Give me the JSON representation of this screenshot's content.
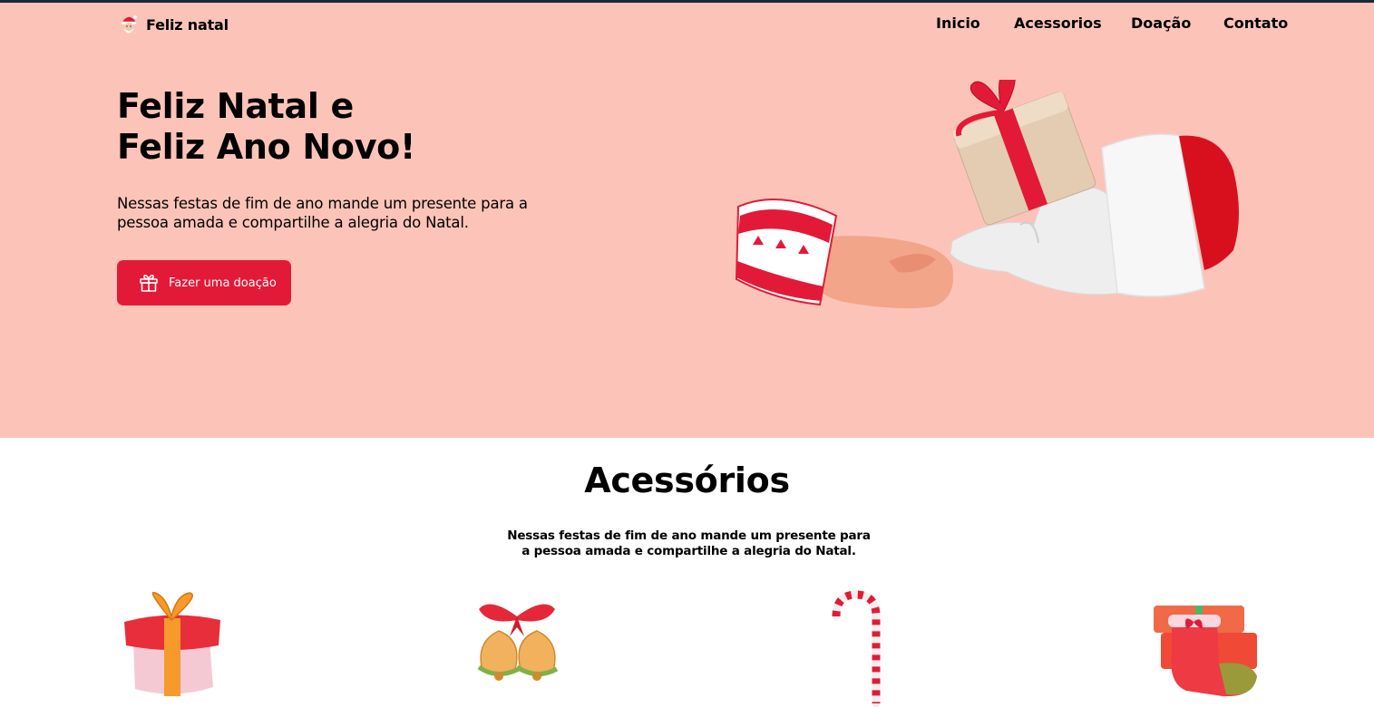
{
  "brand": {
    "name": "Feliz natal",
    "icon": "santa-icon"
  },
  "nav": {
    "items": [
      "Inicio",
      "Acessorios",
      "Doação",
      "Contato"
    ]
  },
  "hero": {
    "title_line1": "Feliz Natal e",
    "title_line2": "Feliz Ano Novo!",
    "text": "Nessas festas de fim de ano mande um presente para a pessoa amada e compartilhe a alegria do Natal.",
    "cta_label": "Fazer uma doação",
    "cta_icon": "gift-icon",
    "image": "hands-giving-gift-illustration"
  },
  "accessories": {
    "title": "Acessórios",
    "text": "Nessas festas de fim de ano mande um presente para a pessoa amada e compartilhe a alegria do Natal.",
    "items": [
      {
        "icon": "gift-box-icon"
      },
      {
        "icon": "christmas-bells-icon"
      },
      {
        "icon": "candy-cane-icon"
      },
      {
        "icon": "christmas-stocking-icon"
      }
    ]
  },
  "colors": {
    "hero_bg": "#fcc4b9",
    "accent": "#e21a37",
    "topline": "#1b2a3a"
  }
}
